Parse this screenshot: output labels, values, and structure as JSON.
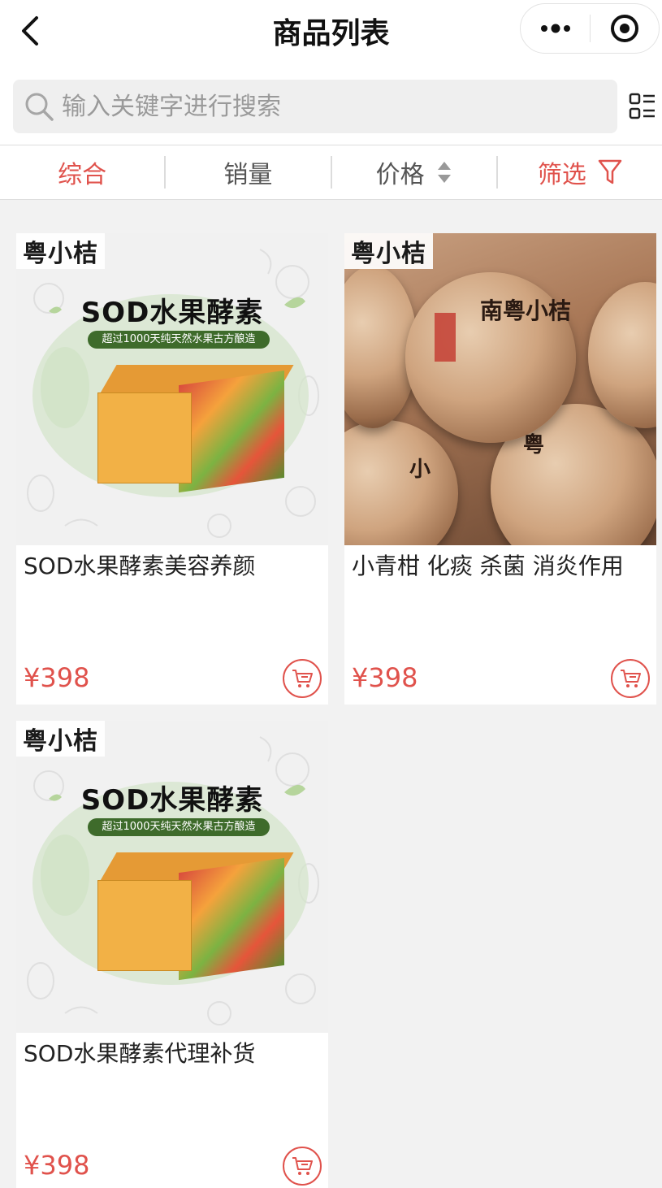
{
  "header": {
    "title": "商品列表"
  },
  "search": {
    "placeholder": "输入关键字进行搜索"
  },
  "filters": [
    {
      "label": "综合",
      "active": true
    },
    {
      "label": "销量",
      "active": false
    },
    {
      "label": "价格",
      "active": false
    },
    {
      "label": "筛选",
      "active": false
    }
  ],
  "products": [
    {
      "name": "SOD水果酵素美容养颜",
      "price": "¥398",
      "image": {
        "kind": "sod",
        "brand": "粤小桔",
        "headline": "SOD水果酵素",
        "ribbon": "超过1000天纯天然水果古方酿造"
      }
    },
    {
      "name": "小青柑 化痰 杀菌 消炎作用",
      "price": "¥398",
      "image": {
        "kind": "tangerine",
        "brand": "粤小桔",
        "ball_text": "南粤小桔"
      }
    },
    {
      "name": "SOD水果酵素代理补货",
      "price": "¥398",
      "image": {
        "kind": "sod",
        "brand": "粤小桔",
        "headline": "SOD水果酵素",
        "ribbon": "超过1000天纯天然水果古方酿造"
      }
    }
  ],
  "colors": {
    "accent": "#e0524c",
    "background": "#f2f2f2"
  }
}
